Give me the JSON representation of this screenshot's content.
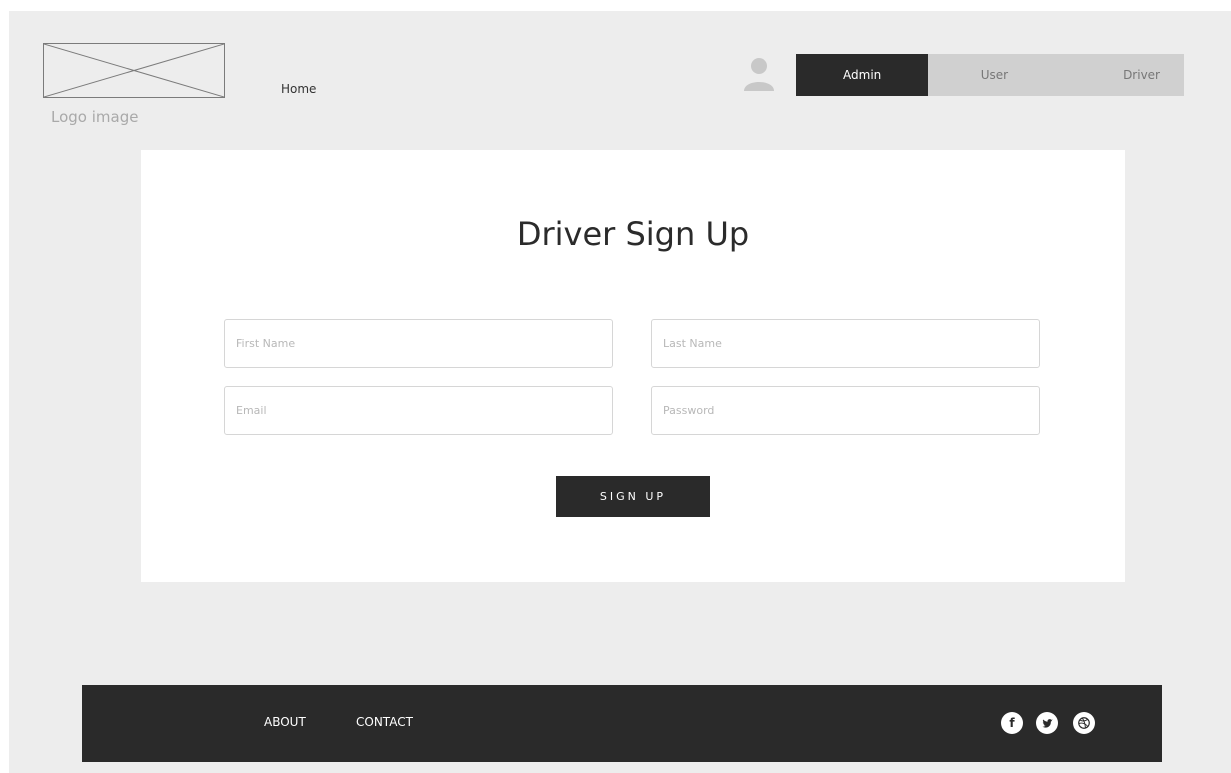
{
  "header": {
    "logo_caption": "Logo image",
    "nav": {
      "home_label": "Home"
    },
    "role_tabs": [
      {
        "label": "Admin",
        "active": true
      },
      {
        "label": "User",
        "active": false
      },
      {
        "label": "Driver",
        "active": false
      }
    ]
  },
  "form": {
    "title": "Driver Sign Up",
    "first_name_placeholder": "First Name",
    "last_name_placeholder": "Last Name",
    "email_placeholder": "Email",
    "password_placeholder": "Password",
    "submit_label": "SIGN UP"
  },
  "footer": {
    "links": [
      {
        "label": "ABOUT"
      },
      {
        "label": "CONTACT"
      }
    ],
    "social": [
      {
        "icon": "facebook-icon",
        "glyph": "f"
      },
      {
        "icon": "twitter-icon"
      },
      {
        "icon": "dribbble-icon"
      }
    ]
  },
  "colors": {
    "background": "#ededed",
    "card": "#ffffff",
    "dark": "#2a2a2a",
    "tab_inactive": "#d0d0d0"
  }
}
